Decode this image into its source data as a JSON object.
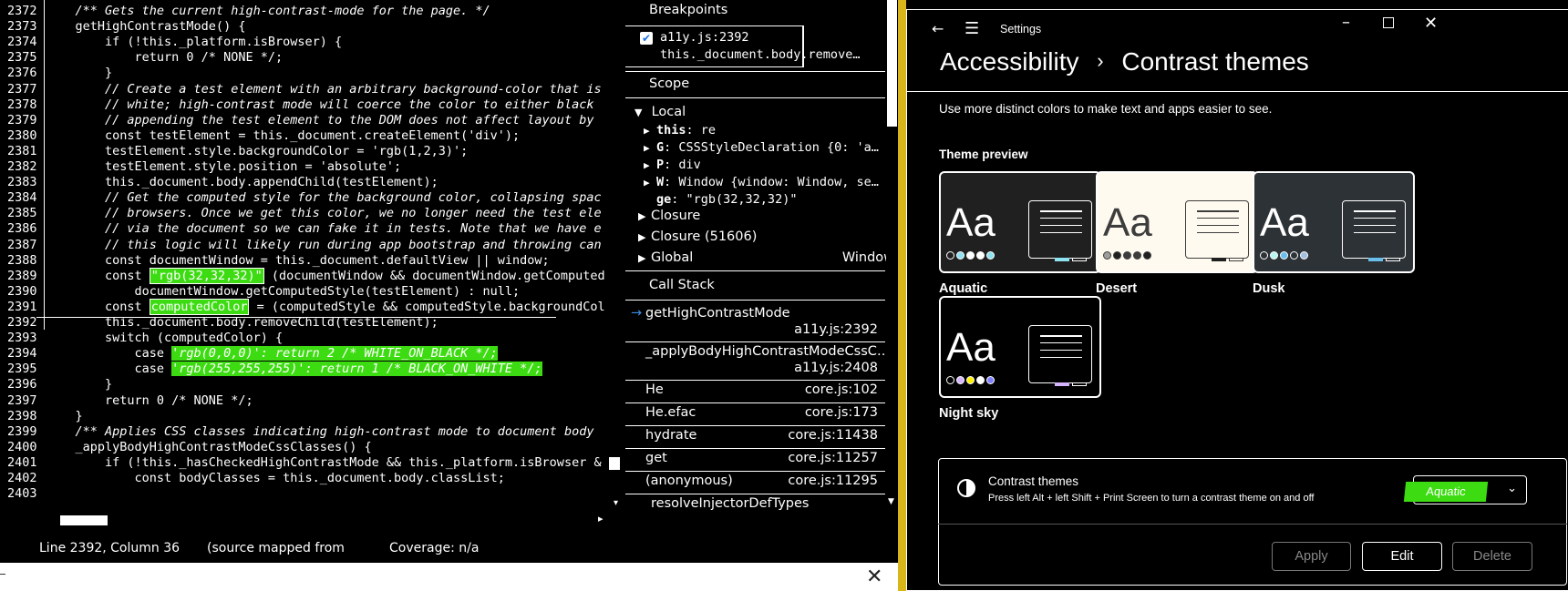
{
  "editor": {
    "lines": [
      {
        "n": "2372",
        "t": "    /** Gets the current high-contrast-mode for the page. */",
        "it": true
      },
      {
        "n": "2373",
        "t": "    getHighContrastMode() {"
      },
      {
        "n": "2374",
        "t": "        if (!this._platform.isBrowser) {"
      },
      {
        "n": "2375",
        "t": "            return 0 /* NONE */;"
      },
      {
        "n": "2376",
        "t": "        }"
      },
      {
        "n": "2377",
        "t": "        // Create a test element with an arbitrary background-color that is",
        "it": true
      },
      {
        "n": "2378",
        "t": "        // white; high-contrast mode will coerce the color to either black",
        "it": true
      },
      {
        "n": "2379",
        "t": "        // appending the test element to the DOM does not affect layout by",
        "it": true
      },
      {
        "n": "2380",
        "t": "        const testElement = this._document.createElement('div');"
      },
      {
        "n": "2381",
        "t": "        testElement.style.backgroundColor = 'rgb(1,2,3)';"
      },
      {
        "n": "2382",
        "t": "        testElement.style.position = 'absolute';"
      },
      {
        "n": "2383",
        "t": "        this._document.body.appendChild(testElement);"
      },
      {
        "n": "2384",
        "t": "        // Get the computed style for the background color, collapsing spac",
        "it": true
      },
      {
        "n": "2385",
        "t": "        // browsers. Once we get this color, we no longer need the test ele",
        "it": true
      },
      {
        "n": "2386",
        "t": "        // via the document so we can fake it in tests. Note that we have e",
        "it": true
      },
      {
        "n": "2387",
        "t": "        // this logic will likely run during app bootstrap and throwing can",
        "it": true
      },
      {
        "n": "2388",
        "t": "        const documentWindow = this._document.defaultView || window;"
      },
      {
        "n": "2389",
        "t": "        const ",
        "tooltip": "\"rgb(32,32,32)\"",
        "t2": " (documentWindow && documentWindow.getComputed"
      },
      {
        "n": "2390",
        "t": "            documentWindow.getComputedStyle(testElement) : null;"
      },
      {
        "n": "2391",
        "t": "        const ",
        "hl": "computedColor",
        "t2": " = (computedStyle && computedStyle.backgroundCol"
      },
      {
        "n": "2392",
        "t": "        this._document.body.removeChild(testElement);"
      },
      {
        "n": "2393",
        "t": "        switch (computedColor) {"
      },
      {
        "n": "2394",
        "t": "            case ",
        "hl": "'rgb(0,0,0)': return 2 /* WHITE_ON_BLACK */;"
      },
      {
        "n": "2395",
        "t": "            case ",
        "hl": "'rgb(255,255,255)': return 1 /* BLACK_ON_WHITE */;"
      },
      {
        "n": "2396",
        "t": "        }"
      },
      {
        "n": "2397",
        "t": "        return 0 /* NONE */;"
      },
      {
        "n": "2398",
        "t": "    }"
      },
      {
        "n": "2399",
        "t": "    /** Applies CSS classes indicating high-contrast mode to document body",
        "it": true
      },
      {
        "n": "2400",
        "t": "    _applyBodyHighContrastModeCssClasses() {"
      },
      {
        "n": "2401",
        "t": "        if (!this._hasCheckedHighContrastMode && this._platform.isBrowser &"
      },
      {
        "n": "2402",
        "t": "            const bodyClasses = this._document.body.classList;"
      },
      {
        "n": "2403",
        "t": ""
      }
    ]
  },
  "status": {
    "position": "Line 2392, Column 36",
    "mapped": "(source mapped from",
    "coverage": "Coverage: n/a"
  },
  "debugger": {
    "breakpoints_title": "Breakpoints",
    "breakpoint_file": "a11y.js:2392",
    "breakpoint_code": "this._document.body.remove…",
    "scope_title": "Scope",
    "local_title": "Local",
    "vars": [
      {
        "arrow": true,
        "k": "this",
        "v": "re"
      },
      {
        "arrow": true,
        "k": "G",
        "v": "CSSStyleDeclaration {0: 'a…"
      },
      {
        "arrow": true,
        "k": "P",
        "v": "div"
      },
      {
        "arrow": true,
        "k": "W",
        "v": "Window {window: Window, se…"
      },
      {
        "arrow": false,
        "k": "ge",
        "v": "\"rgb(32,32,32)\""
      }
    ],
    "closure": "Closure",
    "closure2": "Closure (51606)",
    "global": "Global",
    "global_val": "Window",
    "callstack_title": "Call Stack",
    "frames": [
      {
        "fn": "getHighContrastMode",
        "loc": "a11y.js:2392",
        "active": true
      },
      {
        "fn": "_applyBodyHighContrastModeCssC…",
        "loc": "a11y.js:2408"
      },
      {
        "fn": "He",
        "loc": "core.js:102"
      },
      {
        "fn": "He.efac",
        "loc": "core.js:173"
      },
      {
        "fn": "hydrate",
        "loc": "core.js:11438"
      },
      {
        "fn": "get",
        "loc": "core.js:11257"
      },
      {
        "fn": "(anonymous)",
        "loc": "core.js:11295"
      },
      {
        "fn": "resolveInjectorDefTypes",
        "loc": ""
      }
    ]
  },
  "settings": {
    "app_title": "Settings",
    "breadcrumb_parent": "Accessibility",
    "breadcrumb_sep": "›",
    "page_title": "Contrast themes",
    "description": "Use more distinct colors to make text and apps easier to see.",
    "preview_label": "Theme preview",
    "sample": "Aa",
    "themes": [
      {
        "name": "Aquatic",
        "bg": "#202020",
        "fg": "#ffffff",
        "accent": "#8ee3f0",
        "dots": [
          "#202020",
          "#8ee3f0",
          "#ffffff",
          "#ffffff",
          "#8ee3f0"
        ]
      },
      {
        "name": "Desert",
        "bg": "#fffaef",
        "fg": "#3d3d3d",
        "accent": "#202020",
        "dots": [
          "#9d9d9d",
          "#202020",
          "#3d3d3d",
          "#3d3d3d",
          "#202020"
        ]
      },
      {
        "name": "Dusk",
        "bg": "#2d3236",
        "fg": "#ffffff",
        "accent": "#69bfec",
        "dots": [
          "#2d3236",
          "#b6f6f0",
          "#69bfec",
          "#2d3236",
          "#a1bfde"
        ]
      },
      {
        "name": "Night sky",
        "bg": "#000000",
        "fg": "#ffffff",
        "accent": "#d6b4fd",
        "dots": [
          "#000000",
          "#d6b4fd",
          "#fff200",
          "#ffffff",
          "#8080ff"
        ]
      }
    ],
    "card_title": "Contrast themes",
    "card_desc": "Press left Alt + left Shift + Print Screen to turn a contrast theme on and off",
    "dropdown_value": "Aquatic",
    "apply": "Apply",
    "edit": "Edit",
    "delete": "Delete",
    "highlight_color": "#3ddc12"
  }
}
